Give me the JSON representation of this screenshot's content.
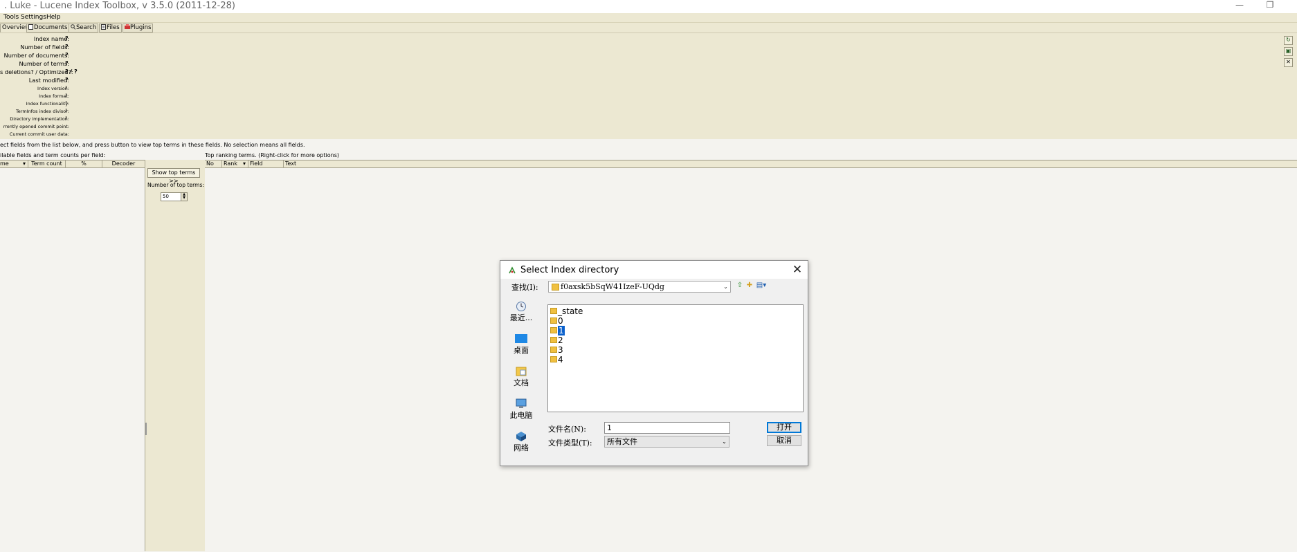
{
  "window": {
    "title": ". Luke - Lucene Index Toolbox, v 3.5.0 (2011-12-28)",
    "minimize_glyph": "—",
    "restore_glyph": "❐"
  },
  "menu": [
    {
      "label": "Tools"
    },
    {
      "label": "Settings"
    },
    {
      "label": "Help"
    }
  ],
  "tabs": [
    {
      "label": "Overview",
      "icon": "overview-icon"
    },
    {
      "label": "Documents",
      "icon": "documents-icon"
    },
    {
      "label": "Search",
      "icon": "search-icon"
    },
    {
      "label": "Files",
      "icon": "files-icon"
    },
    {
      "label": "Plugins",
      "icon": "plugins-icon"
    }
  ],
  "overview": {
    "rows": [
      {
        "label": "Index name:",
        "value": "?"
      },
      {
        "label": "Number of fields:",
        "value": "?"
      },
      {
        "label": "Number of documents:",
        "value": "?"
      },
      {
        "label": "Number of terms:",
        "value": "?"
      },
      {
        "label": "s deletions? / Optimized?:",
        "value": "? / ?"
      },
      {
        "label": "Last modified:",
        "value": "?"
      },
      {
        "label": "Index version:",
        "value": "?"
      },
      {
        "label": "Index format:",
        "value": "?"
      },
      {
        "label": "Index functionality:",
        "value": "?"
      },
      {
        "label": "TermInfos index divisor:",
        "value": "?"
      },
      {
        "label": "Directory implementation:",
        "value": "?"
      },
      {
        "label": "rrently opened commit point:",
        "value": ""
      },
      {
        "label": "Current commit user data:",
        "value": ""
      }
    ]
  },
  "info_text": "ect fields from the list below, and press button to view top terms in these fields. No selection means all fields.",
  "left_label": "ilable fields and term counts per field:",
  "right_label": "Top ranking terms. (Right-click for more options)",
  "left_columns": [
    "me",
    "Term count",
    "%",
    "Decoder"
  ],
  "right_columns": [
    "No",
    "Rank",
    "Field",
    "Text"
  ],
  "show_top_terms_label": "Show top terms >>",
  "num_top_terms_label": "Number of top terms:",
  "num_top_terms_value": "50",
  "dialog": {
    "title": "Select Index directory",
    "look_in_label": "查找(I):",
    "look_in_value": "f0axsk5bSqW41IzeF-UQdg",
    "places": [
      {
        "label": "最近...",
        "icon": "recent-icon"
      },
      {
        "label": "桌面",
        "icon": "desktop-icon"
      },
      {
        "label": "文档",
        "icon": "documents-folder-icon"
      },
      {
        "label": "此电脑",
        "icon": "computer-icon"
      },
      {
        "label": "网络",
        "icon": "network-icon"
      }
    ],
    "files": [
      {
        "name": "_state"
      },
      {
        "name": "0"
      },
      {
        "name": "1"
      },
      {
        "name": "2"
      },
      {
        "name": "3"
      },
      {
        "name": "4"
      }
    ],
    "selected_file": "1",
    "file_name_label": "文件名(N):",
    "file_name_value": "1",
    "file_type_label": "文件类型(T):",
    "file_type_value": "所有文件",
    "open_label": "打开",
    "cancel_label": "取消"
  }
}
